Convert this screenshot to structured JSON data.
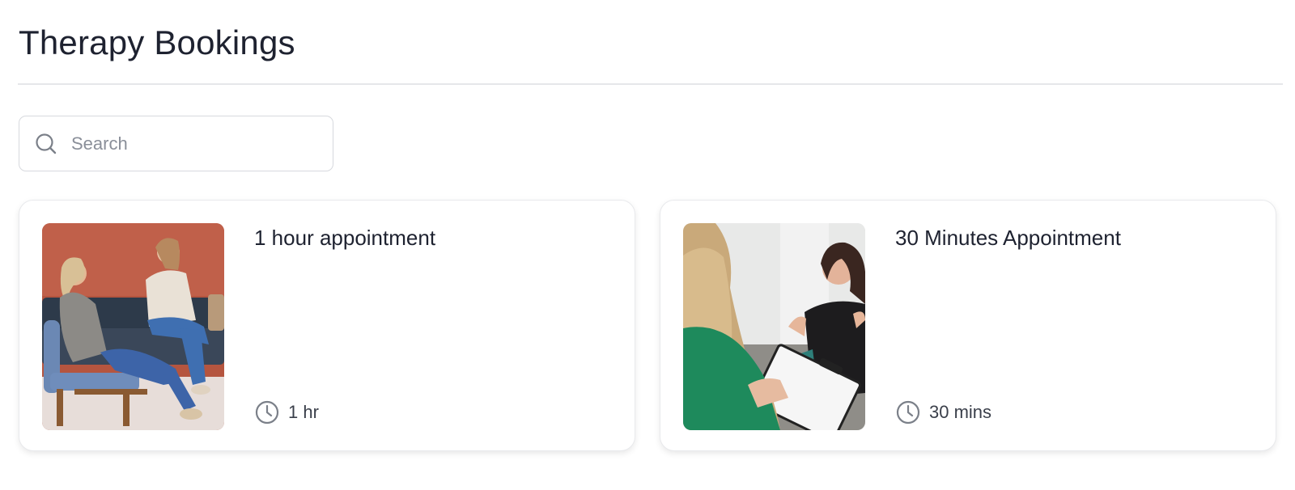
{
  "header": {
    "title": "Therapy Bookings"
  },
  "search": {
    "placeholder": "Search",
    "value": "",
    "icon": "search-icon"
  },
  "services": [
    {
      "title": "1 hour appointment",
      "duration": "1 hr",
      "image": "therapy-session-couch-photo",
      "duration_icon": "clock-icon"
    },
    {
      "title": "30 Minutes Appointment",
      "duration": "30 mins",
      "image": "therapist-with-clipboard-photo",
      "duration_icon": "clock-icon"
    }
  ],
  "colors": {
    "text": "#1e2230",
    "border": "#d7d9de",
    "divider": "#e6e7ea",
    "icon": "#7b8089"
  }
}
